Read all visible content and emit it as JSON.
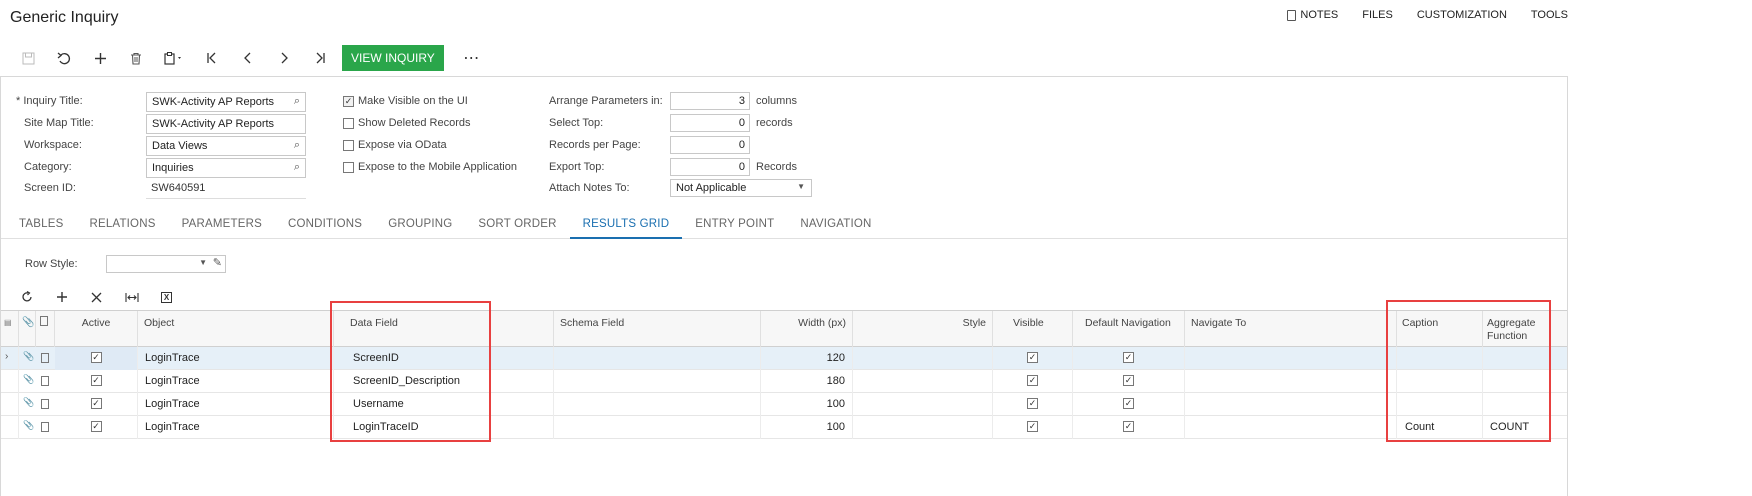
{
  "header": {
    "title": "Generic Inquiry",
    "links": {
      "notes": "NOTES",
      "files": "FILES",
      "customization": "CUSTOMIZATION",
      "tools": "TOOLS"
    }
  },
  "toolbar": {
    "view_inquiry": "VIEW INQUIRY",
    "more": "⋯"
  },
  "form": {
    "inquiry_title": {
      "label": "Inquiry Title:",
      "required_mark": "*",
      "value": "SWK-Activity AP Reports"
    },
    "site_map_title": {
      "label": "Site Map Title:",
      "value": "SWK-Activity AP Reports"
    },
    "workspace": {
      "label": "Workspace:",
      "value": "Data Views"
    },
    "category": {
      "label": "Category:",
      "value": "Inquiries"
    },
    "screen_id": {
      "label": "Screen ID:",
      "value": "SW640591"
    },
    "checkboxes": [
      {
        "label": "Make Visible on the UI",
        "checked": true
      },
      {
        "label": "Show Deleted Records",
        "checked": false
      },
      {
        "label": "Expose via OData",
        "checked": false
      },
      {
        "label": "Expose to the Mobile Application",
        "checked": false
      }
    ],
    "arrange_params": {
      "label": "Arrange Parameters in:",
      "value": "3",
      "unit": "columns"
    },
    "select_top": {
      "label": "Select Top:",
      "value": "0",
      "unit": "records"
    },
    "records_per_page": {
      "label": "Records per Page:",
      "value": "0"
    },
    "export_top": {
      "label": "Export Top:",
      "value": "0",
      "unit": "Records"
    },
    "attach_notes": {
      "label": "Attach Notes To:",
      "value": "Not Applicable"
    }
  },
  "tabs": [
    {
      "label": "TABLES",
      "active": false
    },
    {
      "label": "RELATIONS",
      "active": false
    },
    {
      "label": "PARAMETERS",
      "active": false
    },
    {
      "label": "CONDITIONS",
      "active": false
    },
    {
      "label": "GROUPING",
      "active": false
    },
    {
      "label": "SORT ORDER",
      "active": false
    },
    {
      "label": "RESULTS GRID",
      "active": true
    },
    {
      "label": "ENTRY POINT",
      "active": false
    },
    {
      "label": "NAVIGATION",
      "active": false
    }
  ],
  "results": {
    "row_style_label": "Row Style:",
    "columns": {
      "active": "Active",
      "object": "Object",
      "data_field": "Data Field",
      "schema_field": "Schema Field",
      "width": "Width (px)",
      "style": "Style",
      "visible": "Visible",
      "default_nav": "Default Navigation",
      "navigate_to": "Navigate To",
      "caption": "Caption",
      "aggregate_1": "Aggregate",
      "aggregate_2": "Function"
    },
    "rows": [
      {
        "active": true,
        "object": "LoginTrace",
        "data_field": "ScreenID",
        "width": "120",
        "visible": true,
        "default_nav": true,
        "caption": "",
        "aggregate": ""
      },
      {
        "active": true,
        "object": "LoginTrace",
        "data_field": "ScreenID_Description",
        "width": "180",
        "visible": true,
        "default_nav": true,
        "caption": "",
        "aggregate": ""
      },
      {
        "active": true,
        "object": "LoginTrace",
        "data_field": "Username",
        "width": "100",
        "visible": true,
        "default_nav": true,
        "caption": "",
        "aggregate": ""
      },
      {
        "active": true,
        "object": "LoginTrace",
        "data_field": "LoginTraceID",
        "width": "100",
        "visible": true,
        "default_nav": true,
        "caption": "Count",
        "aggregate": "COUNT"
      }
    ]
  },
  "colors": {
    "accent": "#2aa64a",
    "tab_active": "#1a6fb0",
    "highlight": "#e84040"
  }
}
